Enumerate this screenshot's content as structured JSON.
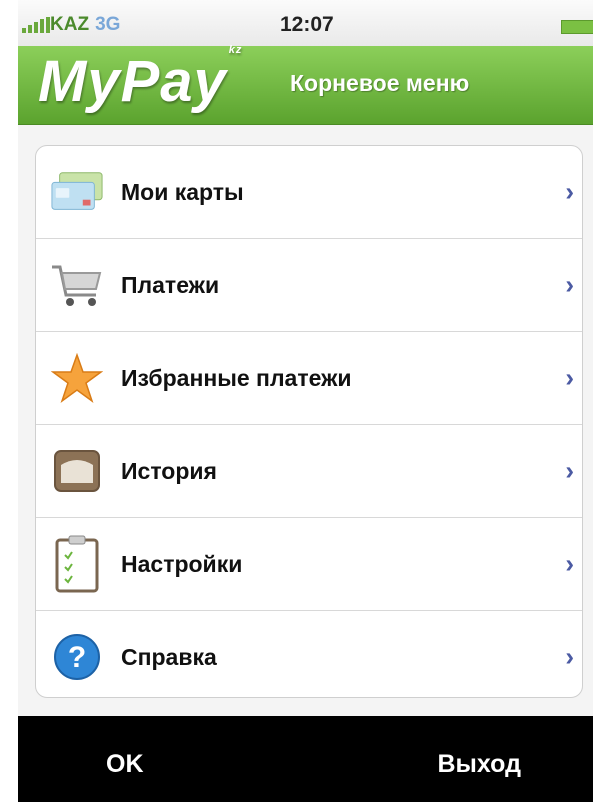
{
  "status_bar": {
    "carrier": "KAZ",
    "network": "3G",
    "time": "12:07"
  },
  "header": {
    "logo": "MyPay",
    "logo_suffix": "kz",
    "title": "Корневое меню"
  },
  "menu": {
    "items": [
      {
        "label": "Мои карты",
        "icon": "cards-icon"
      },
      {
        "label": "Платежи",
        "icon": "shopping-cart-icon"
      },
      {
        "label": "Избранные платежи",
        "icon": "star-icon"
      },
      {
        "label": "История",
        "icon": "history-box-icon"
      },
      {
        "label": "Настройки",
        "icon": "clipboard-icon"
      },
      {
        "label": "Справка",
        "icon": "help-icon"
      }
    ]
  },
  "softkeys": {
    "left": "OK",
    "right": "Выход"
  },
  "colors": {
    "header_green": "#6cb53e",
    "chevron": "#4b5aa3",
    "bottom_bar": "#000000"
  }
}
